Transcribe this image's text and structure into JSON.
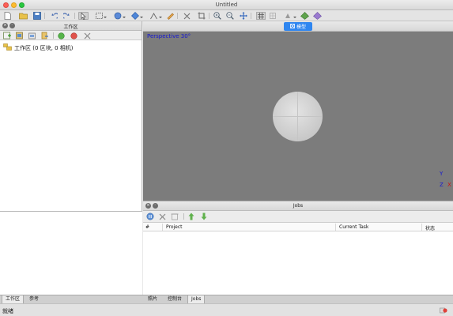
{
  "window": {
    "title": "Untitled"
  },
  "workspace": {
    "title": "工作区",
    "tree_item": "工作区 (0 区块, 0 相机)"
  },
  "viewport": {
    "tab_label": "模型",
    "perspective_label": "Perspective 30°",
    "axis_labels": {
      "y": "Y",
      "z": "Z",
      "x": "X"
    }
  },
  "jobs": {
    "title": "Jobs",
    "columns": [
      "#",
      "Project",
      "Current Task",
      "状态"
    ]
  },
  "bottom_tabs_left": [
    "工作区",
    "参考"
  ],
  "bottom_tabs_right": [
    "照片",
    "控制台",
    "Jobs"
  ],
  "status": {
    "text": "就绪"
  },
  "colors": {
    "accent": "#2f86f0",
    "viewport_bg": "#7c7c7c",
    "label_blue": "#1518d0"
  },
  "icons": {
    "main_toolbar": [
      "new-file-icon",
      "open-folder-icon",
      "save-icon",
      "undo-icon",
      "redo-icon",
      "pointer-icon",
      "rect-select-icon",
      "navigation-icon",
      "region-icon",
      "ruler-icon",
      "eraser-icon",
      "delete-icon",
      "crop-icon",
      "zoom-in-icon",
      "zoom-out-icon",
      "move-icon",
      "grid-icon",
      "tiles-icon",
      "view-mode-icon",
      "solid-icon",
      "texture-icon"
    ],
    "workspace_toolbar": [
      "add-chunk-icon",
      "add-photos-icon",
      "add-folder-icon",
      "import-icon",
      "enable-icon",
      "disable-icon",
      "remove-icon"
    ],
    "jobs_toolbar": [
      "pause-icon",
      "cancel-icon",
      "delete-job-icon",
      "move-up-icon",
      "move-down-icon"
    ]
  }
}
